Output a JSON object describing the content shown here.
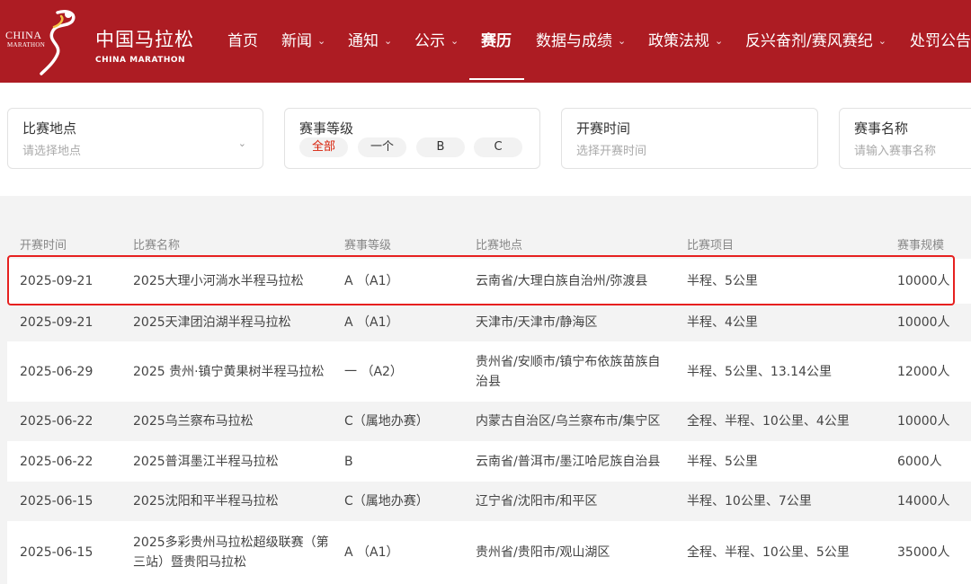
{
  "header": {
    "logo_cn": "中国马拉松",
    "logo_en": "CHINA MARATHON",
    "logo_mark_china": "CHINA",
    "logo_mark_marathon": "MARATHON",
    "nav": [
      {
        "label": "首页",
        "dropdown": false,
        "active": false
      },
      {
        "label": "新闻",
        "dropdown": true,
        "active": false
      },
      {
        "label": "通知",
        "dropdown": true,
        "active": false
      },
      {
        "label": "公示",
        "dropdown": true,
        "active": false
      },
      {
        "label": "赛历",
        "dropdown": false,
        "active": true
      },
      {
        "label": "数据与成绩",
        "dropdown": true,
        "active": false
      },
      {
        "label": "政策法规",
        "dropdown": true,
        "active": false
      },
      {
        "label": "反兴奋剂/赛风赛纪",
        "dropdown": true,
        "active": false
      },
      {
        "label": "处罚公告",
        "dropdown": false,
        "active": false
      }
    ],
    "chevron_glyph": "⌄"
  },
  "filters": {
    "location": {
      "label": "比赛地点",
      "placeholder": "请选择地点"
    },
    "level": {
      "label": "赛事等级",
      "options": [
        "全部",
        "一个",
        "B",
        "C"
      ],
      "selected": "全部"
    },
    "time": {
      "label": "开赛时间",
      "placeholder": "选择开赛时间"
    },
    "name": {
      "label": "赛事名称",
      "placeholder": "请输入赛事名称"
    }
  },
  "table": {
    "columns": [
      "开赛时间",
      "比赛名称",
      "赛事等级",
      "比赛地点",
      "比赛项目",
      "赛事规模"
    ],
    "rows": [
      [
        "2025-09-21",
        "2025大理小河淌水半程马拉松",
        "A （A1）",
        "云南省/大理白族自治州/弥渡县",
        "半程、5公里",
        "10000人"
      ],
      [
        "2025-09-21",
        "2025天津团泊湖半程马拉松",
        "A （A1）",
        "天津市/天津市/静海区",
        "半程、4公里",
        "10000人"
      ],
      [
        "2025-06-29",
        "2025 贵州·镇宁黄果树半程马拉松",
        "一 （A2）",
        "贵州省/安顺市/镇宁布依族苗族自治县",
        "半程、5公里、13.14公里",
        "12000人"
      ],
      [
        "2025-06-22",
        "2025乌兰察布马拉松",
        "C（属地办赛）",
        "内蒙古自治区/乌兰察布市/集宁区",
        "全程、半程、10公里、4公里",
        "10000人"
      ],
      [
        "2025-06-22",
        "2025普洱墨江半程马拉松",
        "B",
        "云南省/普洱市/墨江哈尼族自治县",
        "半程、5公里",
        "6000人"
      ],
      [
        "2025-06-15",
        "2025沈阳和平半程马拉松",
        "C（属地办赛）",
        "辽宁省/沈阳市/和平区",
        "半程、10公里、7公里",
        "14000人"
      ],
      [
        "2025-06-15",
        "2025多彩贵州马拉松超级联赛（第三站）暨贵阳马拉松",
        "A （A1）",
        "贵州省/贵阳市/观山湖区",
        "全程、半程、10公里、5公里",
        "35000人"
      ]
    ],
    "highlighted_row": 0
  }
}
